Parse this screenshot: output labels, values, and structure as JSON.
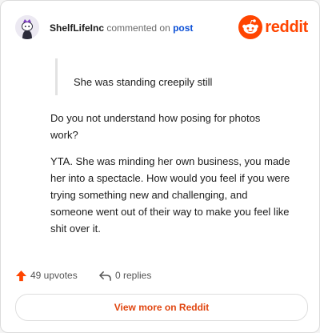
{
  "header": {
    "username": "ShelfLifeInc",
    "action_text": "commented on",
    "post_link": "post",
    "brand_name": "reddit"
  },
  "comment": {
    "quote": "She was standing creepily still",
    "paragraphs": [
      "Do you not understand how posing for photos work?",
      "YTA. She was minding her own business, you made her into a spectacle. How would you feel if you were trying something new and challenging, and someone went out of their way to make you feel like shit over it."
    ]
  },
  "footer": {
    "upvotes": "49 upvotes",
    "replies": "0 replies",
    "more_button": "View more on Reddit"
  },
  "icons": {
    "avatar": "snoo-avatar-icon",
    "brand_logo": "reddit-logo-icon",
    "upvote": "upvote-arrow-icon",
    "reply": "reply-arrow-icon"
  },
  "colors": {
    "brand": "#ff4500",
    "link": "#0b4fd6",
    "button_text": "#e0450f",
    "upvote_arrow": "#ff4500"
  }
}
